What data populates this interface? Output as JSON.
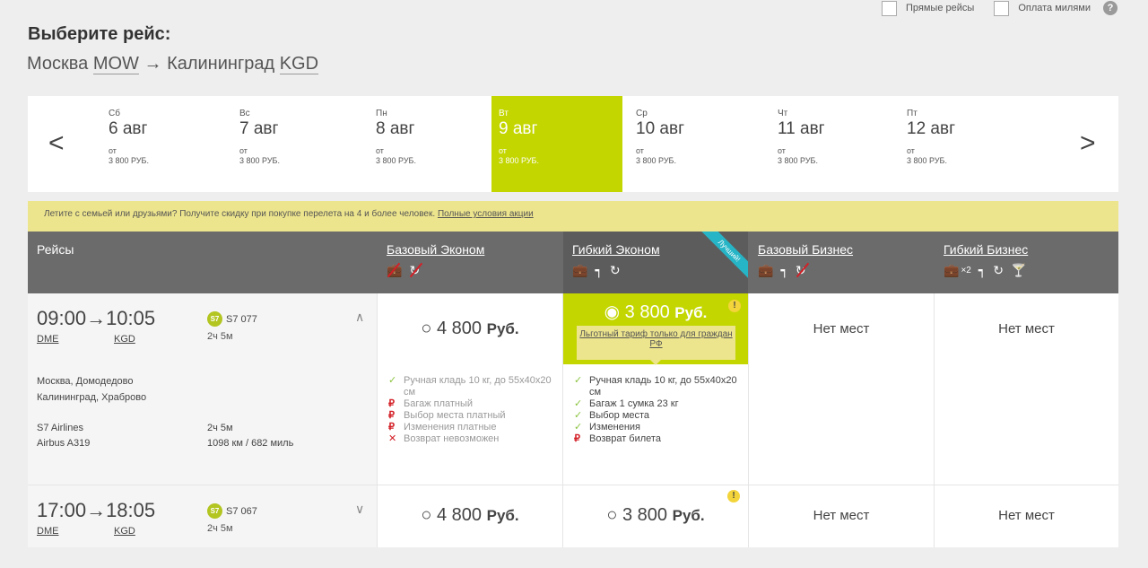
{
  "filters": {
    "direct": "Прямые рейсы",
    "miles": "Оплата милями",
    "help": "?"
  },
  "title": "Выберите рейс:",
  "route": {
    "from": "Москва",
    "from_code": "MOW",
    "arrow": "→",
    "to": "Калининград",
    "to_code": "KGD"
  },
  "nav": {
    "prev": "<",
    "next": ">"
  },
  "dates": [
    {
      "dow": "Сб",
      "day": "6 авг",
      "ot": "от",
      "price": "3 800 РУБ."
    },
    {
      "dow": "Вс",
      "day": "7 авг",
      "ot": "от",
      "price": "3 800 РУБ."
    },
    {
      "dow": "Пн",
      "day": "8 авг",
      "ot": "от",
      "price": "3 800 РУБ."
    },
    {
      "dow": "Вт",
      "day": "9 авг",
      "ot": "от",
      "price": "3 800 РУБ."
    },
    {
      "dow": "Ср",
      "day": "10 авг",
      "ot": "от",
      "price": "3 800 РУБ."
    },
    {
      "dow": "Чт",
      "day": "11 авг",
      "ot": "от",
      "price": "3 800 РУБ."
    },
    {
      "dow": "Пт",
      "day": "12 авг",
      "ot": "от",
      "price": "3 800 РУБ."
    }
  ],
  "promo": {
    "text": "Летите с семьей или друзьями? Получите скидку при покупке перелета на 4 и более человек. ",
    "link": "Полные условия акции"
  },
  "columns": {
    "flights": "Рейсы",
    "base_eco": "Базовый Эконом",
    "flex_eco": "Гибкий Эконом",
    "best": "Лучший!",
    "base_biz": "Базовый Бизнес",
    "flex_biz": "Гибкий Бизнес",
    "x2": "×2"
  },
  "icons": {
    "bag": "suitcase-icon",
    "seat": "seat-icon",
    "change": "refresh-icon",
    "bar": "cocktail-icon"
  },
  "flights": [
    {
      "dep": "09:00",
      "arr": "10:05",
      "dep_code": "DME",
      "arr_code": "KGD",
      "airline": "S7",
      "flight": "S7 077",
      "duration": "2ч 5м",
      "city_from": "Москва, Домодедово",
      "city_to": "Калининград, Храброво",
      "carrier": "S7 Airlines",
      "aircraft": "Airbus A319",
      "duration2": "2ч 5м",
      "distance": "1098 км / 682 миль",
      "base_eco_price": "4 800",
      "flex_eco_price": "3 800",
      "cur": "Руб.",
      "note": "Льготный тариф только для граждан РФ",
      "no_seats": "Нет мест",
      "base_features": [
        "Ручная кладь 10 кг, до 55х40х20 см",
        "Багаж платный",
        "Выбор места платный",
        "Изменения платные",
        "Возврат невозможен"
      ],
      "flex_features": [
        "Ручная кладь 10 кг, до 55х40х20 см",
        "Багаж 1 сумка 23 кг",
        "Выбор места",
        "Изменения",
        "Возврат билета"
      ]
    },
    {
      "dep": "17:00",
      "arr": "18:05",
      "dep_code": "DME",
      "arr_code": "KGD",
      "airline": "S7",
      "flight": "S7 067",
      "duration": "2ч 5м",
      "base_eco_price": "4 800",
      "flex_eco_price": "3 800",
      "cur": "Руб.",
      "no_seats": "Нет мест"
    }
  ],
  "colors": {
    "accent": "#c3d600",
    "header": "#6b6b6b",
    "promo": "#ede58d",
    "ribbon": "#26b5c6",
    "ok": "#8bc440",
    "bad": "#d32027"
  }
}
